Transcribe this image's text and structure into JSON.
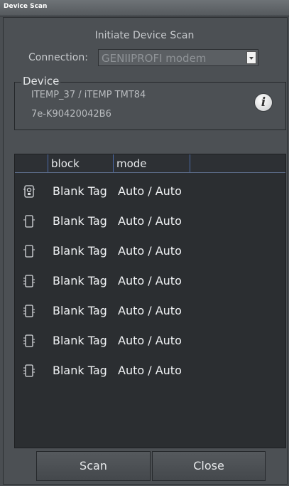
{
  "window": {
    "title": "Device Scan"
  },
  "heading": "Initiate Device Scan",
  "connection": {
    "label": "Connection:",
    "value": "GENIIPROFI modem"
  },
  "device": {
    "legend": "Device",
    "line1": "ITEMP_37 / iTEMP TMT84",
    "line2": "7e-K90420042B6"
  },
  "table": {
    "columns": [
      "",
      "block",
      "mode",
      ""
    ],
    "rows": [
      {
        "icon": "transmitter-device-icon",
        "block": "Blank Tag",
        "mode": "Auto / Auto"
      },
      {
        "icon": "function-block-icon",
        "block": "Blank Tag",
        "mode": "Auto / Auto"
      },
      {
        "icon": "function-block-icon",
        "block": "Blank Tag",
        "mode": "Auto / Auto"
      },
      {
        "icon": "function-block-multi-io-icon",
        "block": "Blank Tag",
        "mode": "Auto / Auto"
      },
      {
        "icon": "function-block-multi-io-icon",
        "block": "Blank Tag",
        "mode": "Auto / Auto"
      },
      {
        "icon": "function-block-multi-io-icon",
        "block": "Blank Tag",
        "mode": "Auto / Auto"
      },
      {
        "icon": "function-block-multi-io-icon",
        "block": "Blank Tag",
        "mode": "Auto / Auto"
      }
    ]
  },
  "buttons": {
    "scan": "Scan",
    "close": "Close"
  },
  "icons": {
    "info": "info-icon",
    "dropdown": "chevron-down-icon"
  }
}
